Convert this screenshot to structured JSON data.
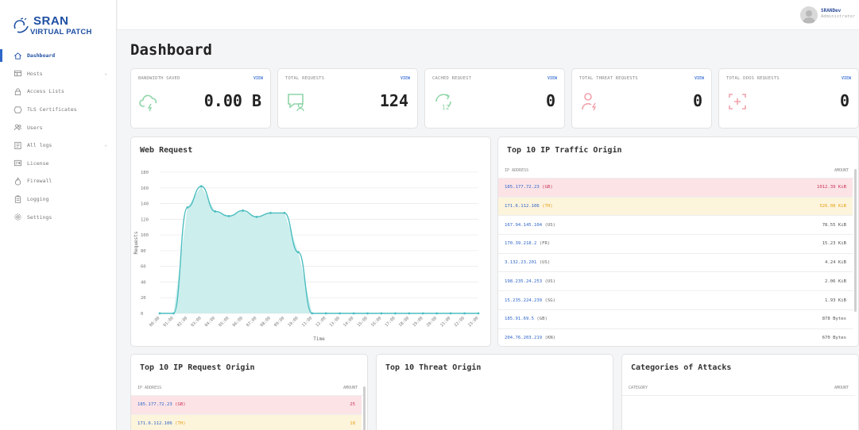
{
  "brand": {
    "line1": "SRAN",
    "line2": "VIRTUAL PATCH",
    "color": "#1e4fa3"
  },
  "user": {
    "name": "SRANDev",
    "role": "Administrator"
  },
  "sidebar": {
    "items": [
      {
        "label": "Dashboard",
        "icon": "home-icon",
        "active": true
      },
      {
        "label": "Hosts",
        "icon": "hosts-icon",
        "caret": "⌄"
      },
      {
        "label": "Access Lists",
        "icon": "lock-icon"
      },
      {
        "label": "TLS Certificates",
        "icon": "shield-icon"
      },
      {
        "label": "Users",
        "icon": "users-icon"
      },
      {
        "label": "All logs",
        "icon": "logs-icon",
        "caret": "⌄"
      },
      {
        "label": "License",
        "icon": "license-icon"
      },
      {
        "label": "Firewall",
        "icon": "firewall-icon"
      },
      {
        "label": "Logging",
        "icon": "logging-icon"
      },
      {
        "label": "Settings",
        "icon": "gear-icon"
      }
    ]
  },
  "page": {
    "title": "Dashboard"
  },
  "stats": [
    {
      "label": "BANDWIDTH SAVED",
      "view": "VIEW",
      "value": "0.00 B",
      "icon": "cloud-bolt-icon",
      "color": "#7fcf9a"
    },
    {
      "label": "TOTAL REQUESTS",
      "view": "VIEW",
      "value": "124",
      "icon": "chat-user-icon",
      "color": "#7fcf9a"
    },
    {
      "label": "CACHED REQUEST",
      "view": "VIEW",
      "value": "0",
      "icon": "refresh-12-icon",
      "color": "#7fcf9a"
    },
    {
      "label": "TOTAL THREAT REQUESTS",
      "view": "VIEW",
      "value": "0",
      "icon": "user-bolt-icon",
      "color": "#f19aa6"
    },
    {
      "label": "TOTAL DDOS REQUESTS",
      "view": "VIEW",
      "value": "0",
      "icon": "focus-plus-icon",
      "color": "#f19aa6"
    }
  ],
  "web_request": {
    "title": "Web Request",
    "chart_data": {
      "type": "area",
      "title": "Web Request",
      "xlabel": "Time",
      "ylabel": "Requests",
      "x": [
        "00:00",
        "01:00",
        "02:00",
        "03:00",
        "04:00",
        "05:00",
        "06:00",
        "07:00",
        "08:00",
        "09:00",
        "10:00",
        "11:00",
        "12:00",
        "13:00",
        "14:00",
        "15:00",
        "16:00",
        "17:00",
        "18:00",
        "19:00",
        "20:00",
        "21:00",
        "22:00",
        "23:00"
      ],
      "y_ticks": [
        0,
        20,
        40,
        60,
        80,
        100,
        120,
        140,
        160,
        180
      ],
      "ylim": [
        0,
        180
      ],
      "values": [
        0,
        0,
        135,
        162,
        130,
        124,
        131,
        123,
        128,
        128,
        78,
        0,
        0,
        0,
        0,
        0,
        0,
        0,
        0,
        0,
        0,
        0,
        0,
        0
      ],
      "line_color": "#4bbdbf",
      "fill_color": "#cceeed",
      "grid": true
    }
  },
  "traffic_origin": {
    "title": "Top 10 IP Traffic Origin",
    "col_ip": "IP ADDRESS",
    "col_amount": "AMOUNT",
    "rows": [
      {
        "ip": "185.177.72.23",
        "cc": "(GB)",
        "amount": "1012.39 KiB",
        "hl": "pink"
      },
      {
        "ip": "171.6.112.106",
        "cc": "(TH)",
        "amount": "526.08 KiB",
        "hl": "yellow"
      },
      {
        "ip": "167.94.145.104",
        "cc": "(US)",
        "amount": "78.55 KiB",
        "hl": ""
      },
      {
        "ip": "170.39.218.2",
        "cc": "(FR)",
        "amount": "15.23 KiB",
        "hl": ""
      },
      {
        "ip": "3.132.23.201",
        "cc": "(US)",
        "amount": "4.24 KiB",
        "hl": ""
      },
      {
        "ip": "198.235.24.253",
        "cc": "(US)",
        "amount": "2.06 KiB",
        "hl": ""
      },
      {
        "ip": "15.235.224.239",
        "cc": "(SG)",
        "amount": "1.93 KiB",
        "hl": ""
      },
      {
        "ip": "185.91.69.5",
        "cc": "(GB)",
        "amount": "878 Bytes",
        "hl": ""
      },
      {
        "ip": "204.76.203.219",
        "cc": "(KN)",
        "amount": "670 Bytes",
        "hl": ""
      }
    ]
  },
  "request_origin": {
    "title": "Top 10 IP Request Origin",
    "col_ip": "IP ADDRESS",
    "col_amount": "AMOUNT",
    "rows": [
      {
        "ip": "185.177.72.23",
        "cc": "(GB)",
        "amount": "25",
        "hl": "pink"
      },
      {
        "ip": "171.6.112.106",
        "cc": "(TH)",
        "amount": "18",
        "hl": "yellow"
      }
    ]
  },
  "threat_origin": {
    "title": "Top 10 Threat Origin"
  },
  "attack_categories": {
    "title": "Categories of Attacks",
    "col_category": "CATEGORY",
    "col_amount": "AMOUNT"
  }
}
